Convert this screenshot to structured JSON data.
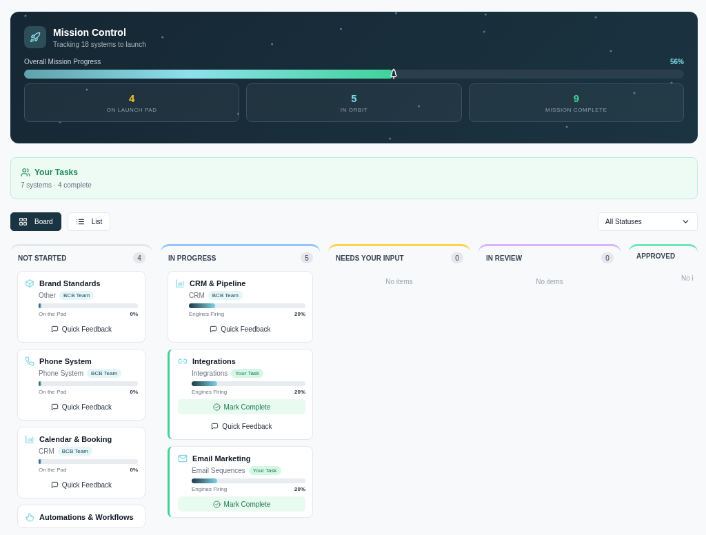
{
  "header": {
    "title": "Mission Control",
    "subtitle": "Tracking 18 systems to launch",
    "progress_label": "Overall Mission Progress",
    "progress_reading": "56%",
    "level": 0.56,
    "stats": [
      {
        "value": "4",
        "label": "ON LAUNCH PAD",
        "color": "#f5c12e"
      },
      {
        "value": "5",
        "label": "IN ORBIT",
        "color": "#7dd8e6"
      },
      {
        "value": "9",
        "label": "MISSION COMPLETE",
        "color": "#3fd39a"
      }
    ]
  },
  "your_tasks": {
    "title": "Your Tasks",
    "summary": "7 systems · 4 complete"
  },
  "views": [
    {
      "label": "Board",
      "kind": "board",
      "selected": true
    },
    {
      "label": "List",
      "kind": "list",
      "selected": false
    }
  ],
  "status_filter": {
    "value": "All Statuses"
  },
  "columns": [
    {
      "title": "NOT STARTED",
      "count": "4",
      "color": "#e5e7eb",
      "cards": [
        {
          "title": "Brand Standards",
          "category": "Other",
          "tag": "BCB Team",
          "your_task": false,
          "level": 0,
          "stage": "On the Pad",
          "percent": "0%",
          "actions": [
            {
              "kind": "feedback",
              "label": "Quick Feedback"
            }
          ]
        },
        {
          "title": "Phone System",
          "category": "Phone System",
          "tag": "BCB Team",
          "your_task": false,
          "level": 0,
          "stage": "On the Pad",
          "percent": "0%",
          "actions": [
            {
              "kind": "feedback",
              "label": "Quick Feedback"
            }
          ]
        },
        {
          "title": "Calendar & Booking",
          "category": "CRM",
          "tag": "BCB Team",
          "your_task": false,
          "level": 0,
          "stage": "On the Pad",
          "percent": "0%",
          "actions": [
            {
              "kind": "feedback",
              "label": "Quick Feedback"
            }
          ]
        },
        {
          "title": "Automations & Workflows"
        }
      ]
    },
    {
      "title": "IN PROGRESS",
      "count": "5",
      "color": "#93c5fd",
      "cards": [
        {
          "title": "CRM & Pipeline",
          "category": "CRM",
          "tag": "BCB Team",
          "your_task": false,
          "level": 0.2,
          "stage": "Engines Firing",
          "percent": "20%",
          "actions": [
            {
              "kind": "feedback",
              "label": "Quick Feedback"
            }
          ]
        },
        {
          "title": "Integrations",
          "category": "Integrations",
          "tag": "Your Task",
          "your_task": true,
          "level": 0.2,
          "stage": "Engines Firing",
          "percent": "20%",
          "actions": [
            {
              "kind": "complete",
              "label": "Mark Complete"
            },
            {
              "kind": "feedback",
              "label": "Quick Feedback"
            }
          ]
        },
        {
          "title": "Email Marketing",
          "category": "Email Sequences",
          "tag": "Your Task",
          "your_task": true,
          "level": 0.2,
          "stage": "Engines Firing",
          "percent": "20%",
          "actions": [
            {
              "kind": "complete",
              "label": "Mark Complete"
            }
          ]
        }
      ]
    },
    {
      "title": "NEEDS YOUR INPUT",
      "count": "0",
      "color": "#fcd34d",
      "empty": "No items"
    },
    {
      "title": "IN REVIEW",
      "count": "0",
      "color": "#d8b4fe",
      "empty": "No items"
    },
    {
      "title": "APPROVED",
      "color": "#6ee7b7",
      "empty": "No i"
    }
  ]
}
